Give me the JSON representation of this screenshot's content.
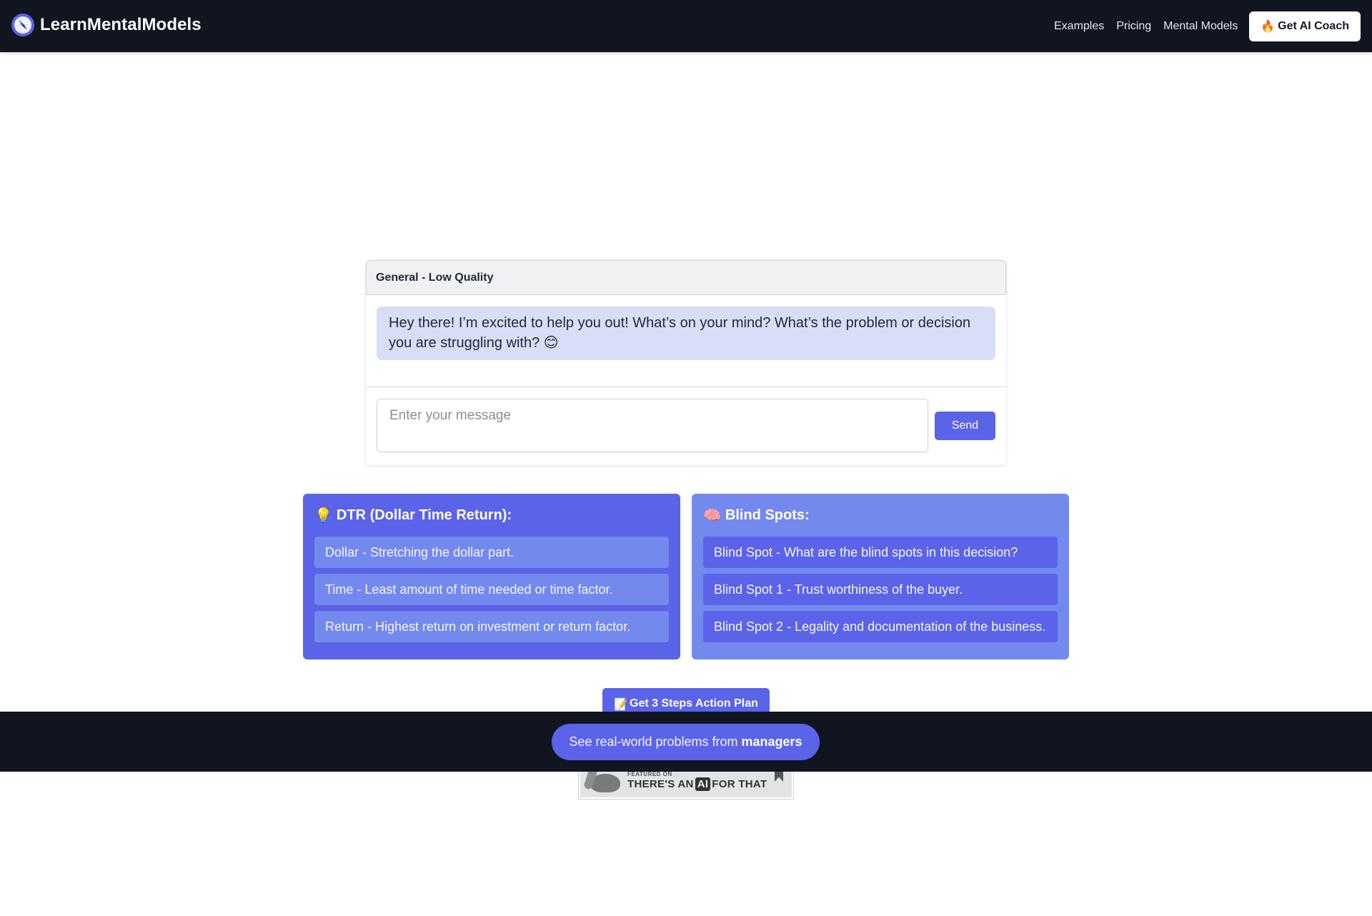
{
  "nav": {
    "brand": "LearnMentalModels",
    "logo_icon": "compass-icon",
    "links": [
      "Examples",
      "Pricing",
      "Mental Models"
    ],
    "cta": {
      "icon": "🔥",
      "label": "Get AI Coach"
    }
  },
  "chat": {
    "header": "General - Low Quality",
    "messages": [
      {
        "role": "assistant",
        "text": "Hey there! I’m excited to help you out! What’s on your mind? What’s the problem or decision you are struggling with? 😊"
      }
    ],
    "input": {
      "value": "",
      "placeholder": "Enter your message"
    },
    "send_label": "Send"
  },
  "panels": [
    {
      "icon": "💡",
      "title": "DTR (Dollar Time Return):",
      "items": [
        "Dollar - Stretching the dollar part.",
        "Time - Least amount of time needed or time factor.",
        "Return - Highest return on investment or return factor."
      ]
    },
    {
      "icon": "🧠",
      "title": "Blind Spots:",
      "items": [
        "Blind Spot - What are the blind spots in this decision?",
        "Blind Spot 1 - Trust worthiness of the buyer.",
        "Blind Spot 2 - Legality and documentation of the business."
      ]
    }
  ],
  "action_plan": {
    "icon": "📝",
    "label": "Get 3 Steps Action Plan"
  },
  "featured": {
    "small": "FEATURED ON",
    "before": "THERE'S AN",
    "chip": "AI",
    "after": "FOR THAT"
  },
  "bottom_bar": {
    "prefix": "See real-world problems from",
    "emphasis": "managers"
  },
  "colors": {
    "nav_bg": "#111520",
    "accent": "#5b63e8",
    "accent_light": "#7489ee",
    "bubble": "#d9ddf6"
  }
}
